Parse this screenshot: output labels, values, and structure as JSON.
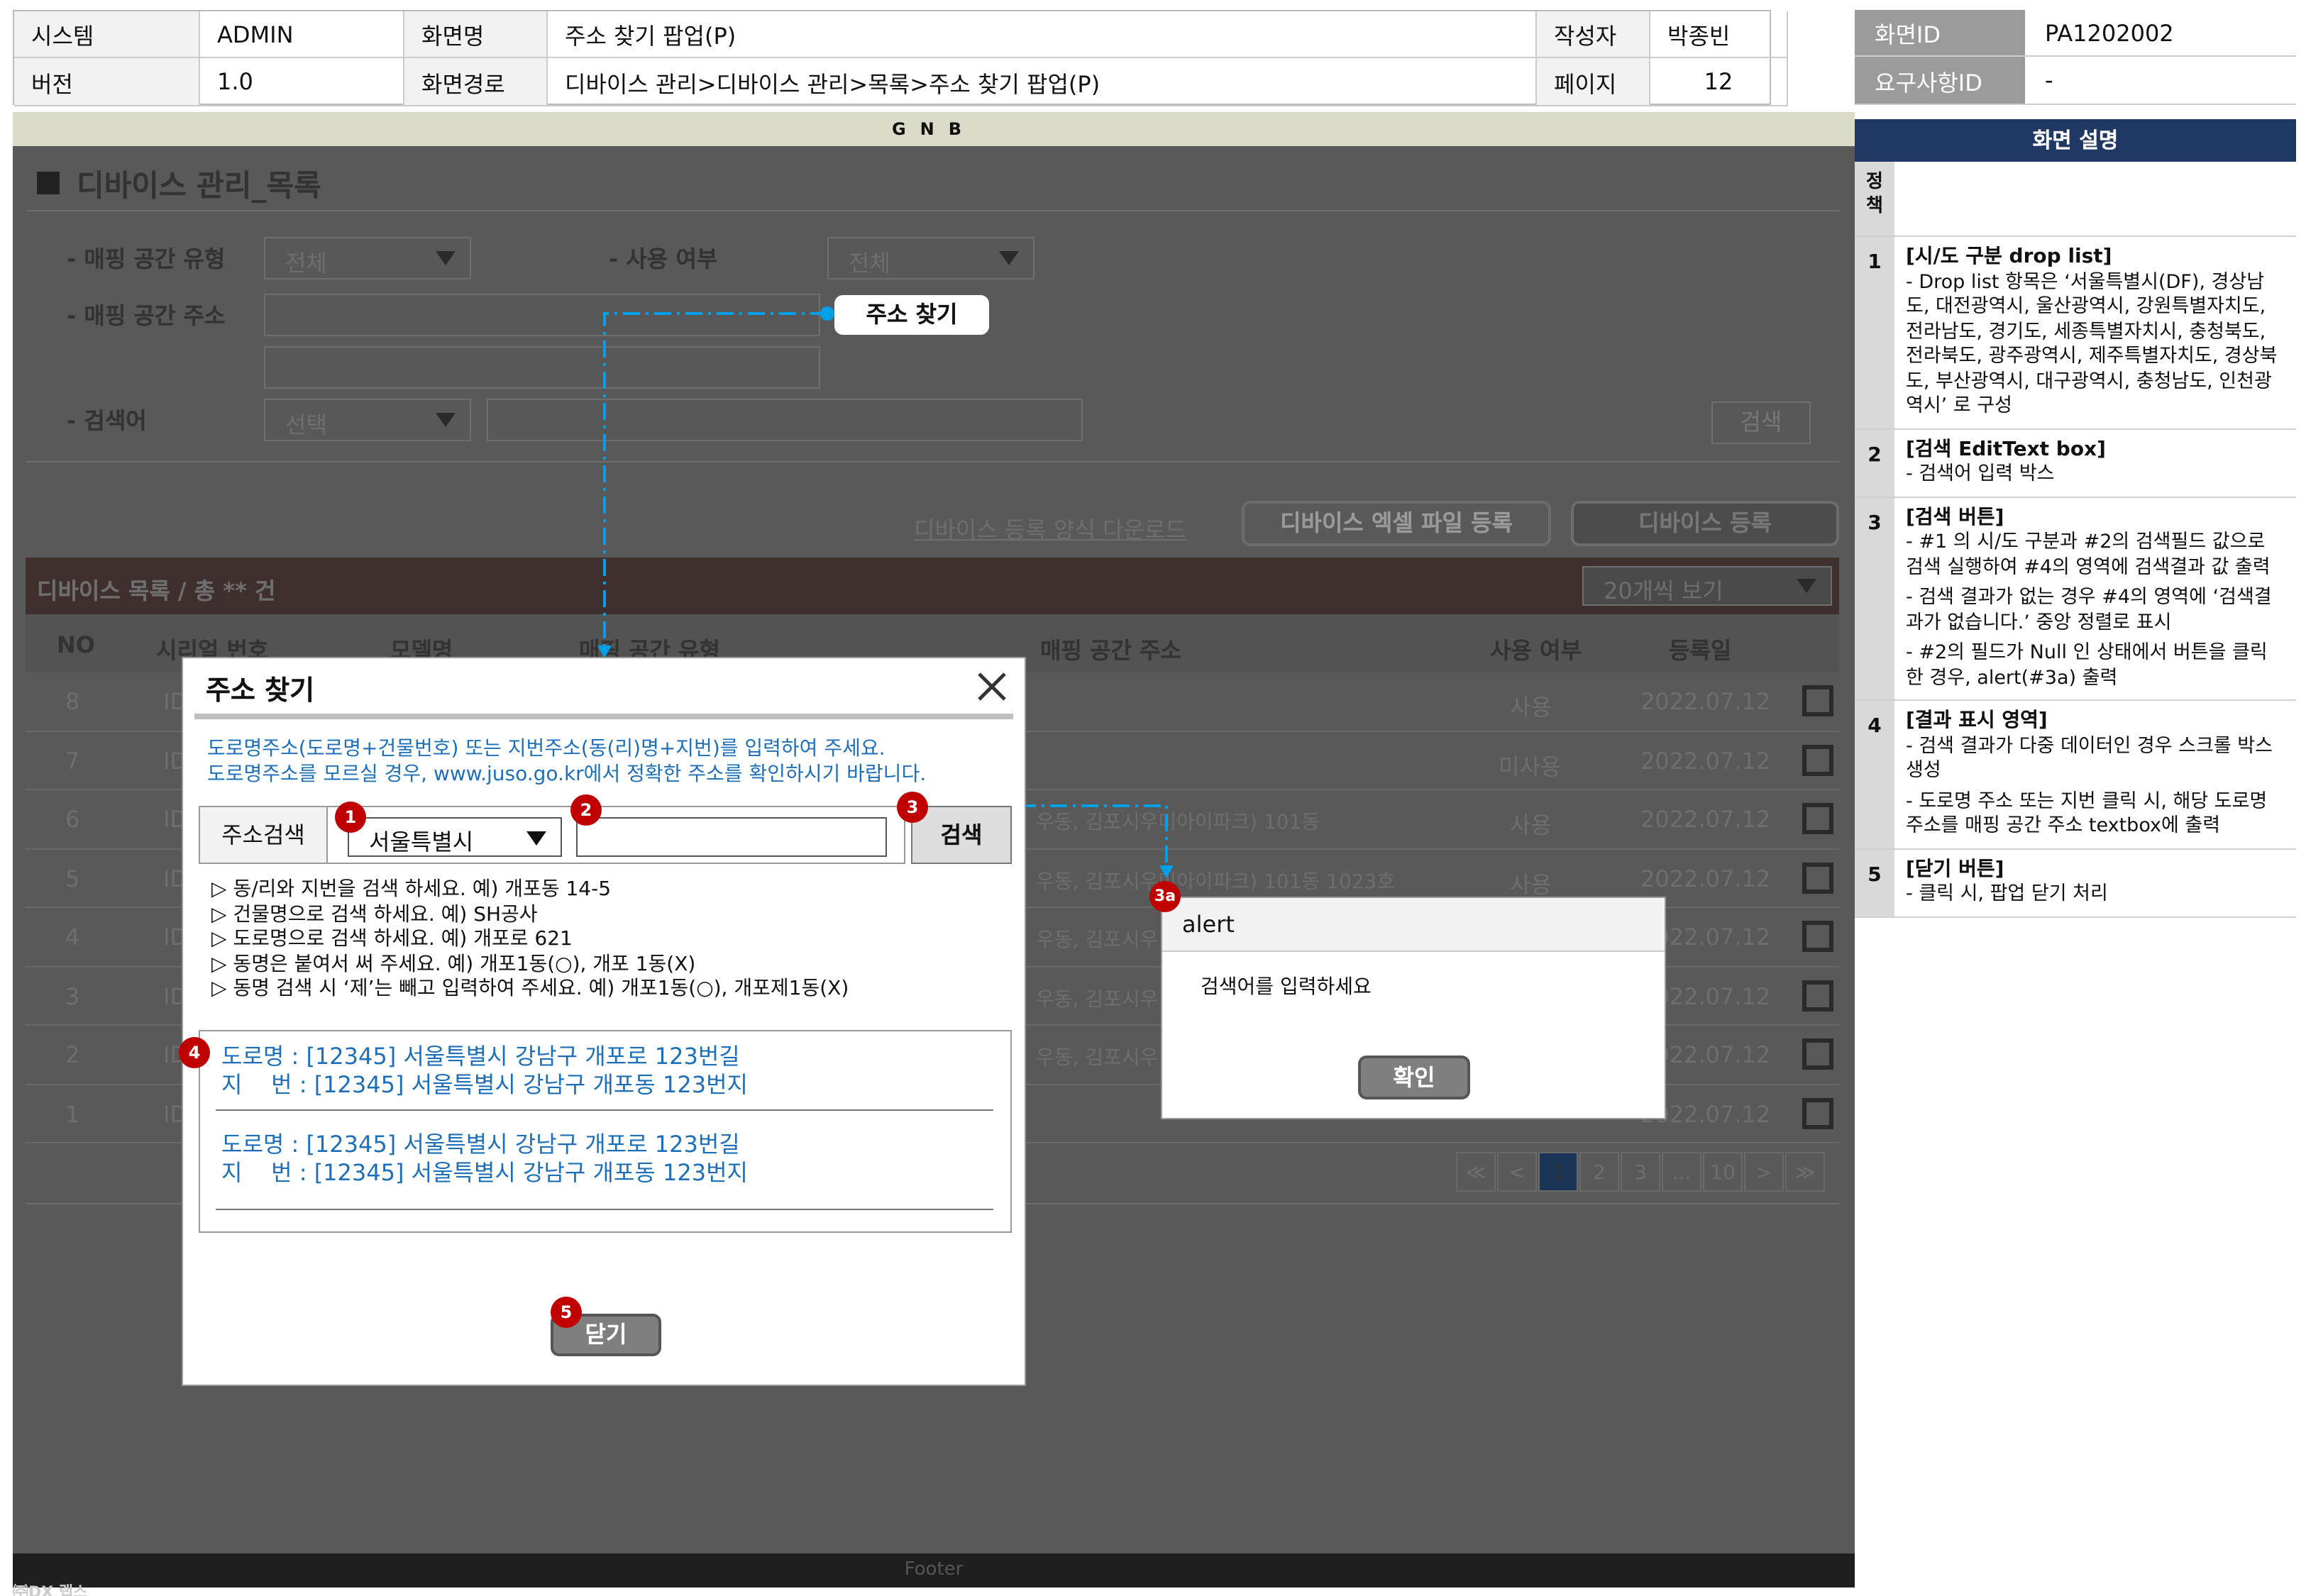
{
  "header": {
    "system_label": "시스템",
    "system_value": "ADMIN",
    "screen_name_label": "화면명",
    "screen_name_value": "주소 찾기 팝업(P)",
    "author_label": "작성자",
    "author_value": "박종빈",
    "version_label": "버전",
    "version_value": "1.0",
    "path_label": "화면경로",
    "path_value": "디바이스 관리>디바이스 관리>목록>주소 찾기 팝업(P)",
    "page_label": "페이지",
    "page_value": "12",
    "screen_id_label": "화면ID",
    "screen_id_value": "PA1202002",
    "req_id_label": "요구사항ID",
    "req_id_value": "-"
  },
  "gnb": "GNB",
  "footer": "Footer",
  "page": {
    "title": "디바이스 관리_목록",
    "filters": {
      "mapping_type_label": "- 매핑 공간 유형",
      "mapping_type_value": "전체",
      "use_label": "- 사용 여부",
      "use_value": "전체",
      "address_label": "- 매핑 공간 주소",
      "find_address_button": "주소 찾기",
      "keyword_label": "- 검색어",
      "keyword_select": "선택",
      "search_button": "검색"
    },
    "actions": {
      "template_link": "디바이스 등록 양식 다운로드",
      "excel_button": "디바이스 엑셀 파일 등록",
      "register_button": "디바이스 등록"
    },
    "list": {
      "title": "디바이스 목록 / 총 ** 건",
      "page_size": "20개씩 보기",
      "columns": [
        "NO",
        "시리얼 번호",
        "모델명",
        "매핑 공간 유형",
        "매핑 공간 주소",
        "사용 여부",
        "등록일"
      ],
      "rows": [
        {
          "no": "8",
          "id": "ID",
          "addr": "",
          "use": "사용",
          "date": "2022.07.12"
        },
        {
          "no": "7",
          "id": "ID",
          "addr": "",
          "use": "미사용",
          "date": "2022.07.12"
        },
        {
          "no": "6",
          "id": "ID",
          "addr": "우동, 김포시우미아이파크) 101동",
          "use": "사용",
          "date": "2022.07.12"
        },
        {
          "no": "5",
          "id": "ID",
          "addr": "우동, 김포시우미아이파크) 101동 1023호",
          "use": "사용",
          "date": "2022.07.12"
        },
        {
          "no": "4",
          "id": "ID",
          "addr": "우동, 김포시우",
          "use": "",
          "date": "2022.07.12"
        },
        {
          "no": "3",
          "id": "ID",
          "addr": "우동, 김포시우",
          "use": "",
          "date": "2022.07.12"
        },
        {
          "no": "2",
          "id": "ID",
          "addr": "우동, 김포시우",
          "use": "",
          "date": "2022.07.12"
        },
        {
          "no": "1",
          "id": "ID",
          "addr": "",
          "use": "",
          "date": "2022.07.12"
        }
      ]
    },
    "pager": [
      "≪",
      "<",
      "1",
      "2",
      "3",
      "...",
      "10",
      ">",
      "≫"
    ]
  },
  "popup": {
    "title": "주소 찾기",
    "guide1": "도로명주소(도로명+건물번호) 또는 지번주소(동(리)명+지번)를 입력하여 주세요.",
    "guide2": "도로명주소를 모르실 경우, www.juso.go.kr에서 정확한 주소를 확인하시기 바랍니다.",
    "search_label": "주소검색",
    "region_select": "서울특별시",
    "search_button": "검색",
    "tips": [
      "▷ 동/리와 지번을 검색 하세요. 예) 개포동 14-5",
      "▷ 건물명으로 검색 하세요. 예) SH공사",
      "▷ 도로명으로 검색 하세요. 예) 개포로 621",
      "▷ 동명은 붙여서 써 주세요. 예) 개포1동(○), 개포 1동(X)",
      "▷ 동명 검색 시 ‘제’는 빼고 입력하여 주세요. 예) 개포1동(○), 개포제1동(X)"
    ],
    "results": [
      {
        "road": "도로명 : [12345] 서울특별시 강남구 개포로 123번길",
        "jibun": "지    번 : [12345] 서울특별시 강남구 개포동 123번지"
      },
      {
        "road": "도로명 : [12345] 서울특별시 강남구 개포로 123번길",
        "jibun": "지    번 : [12345] 서울특별시 강남구 개포동 123번지"
      }
    ],
    "close_button": "닫기"
  },
  "alert": {
    "title": "alert",
    "message": "검색어를 입력하세요",
    "ok_button": "확인"
  },
  "markers": [
    "1",
    "2",
    "3",
    "3a",
    "4",
    "5"
  ],
  "watermark": "㈜DX 랩스",
  "description": {
    "heading": "화면 설명",
    "policy_label": "정책",
    "items": [
      {
        "no": "1",
        "title": "[시/도 구분 drop list]",
        "lines": [
          "- Drop list 항목은 ‘서울특별시(DF), 경상남도, 대전광역시, 울산광역시, 강원특별자치도, 전라남도, 경기도, 세종특별자치시, 충청북도, 전라북도, 광주광역시, 제주특별자치도, 경상북도, 부산광역시, 대구광역시, 충청남도, 인천광역시’ 로 구성"
        ]
      },
      {
        "no": "2",
        "title": "[검색 EditText box]",
        "lines": [
          "- 검색어 입력 박스"
        ]
      },
      {
        "no": "3",
        "title": "[검색 버튼]",
        "lines": [
          "- #1 의 시/도 구분과 #2의 검색필드 값으로 검색 실행하여 #4의 영역에 검색결과 값 출력",
          "- 검색 결과가 없는 경우 #4의 영역에 ‘검색결과가 없습니다.’ 중앙 정렬로 표시",
          "- #2의 필드가 Null 인 상태에서 버튼을 클릭한 경우,  alert(#3a) 출력"
        ]
      },
      {
        "no": "4",
        "title": "[결과 표시 영역]",
        "lines": [
          "- 검색 결과가 다중 데이터인 경우 스크롤 박스 생성",
          "- 도로명 주소 또는 지번 클릭 시, 해당 도로명 주소를 매핑 공간 주소 textbox에 출력"
        ]
      },
      {
        "no": "5",
        "title": "[닫기 버튼]",
        "lines": [
          "- 클릭 시, 팝업 닫기 처리"
        ]
      }
    ]
  },
  "colors": {
    "dim": "#595959",
    "gnb": "#dcdac9",
    "accent_blue": "#1e6fb8",
    "marker_red": "#c00000",
    "side_head": "#203864",
    "connector": "#00a0e9"
  }
}
